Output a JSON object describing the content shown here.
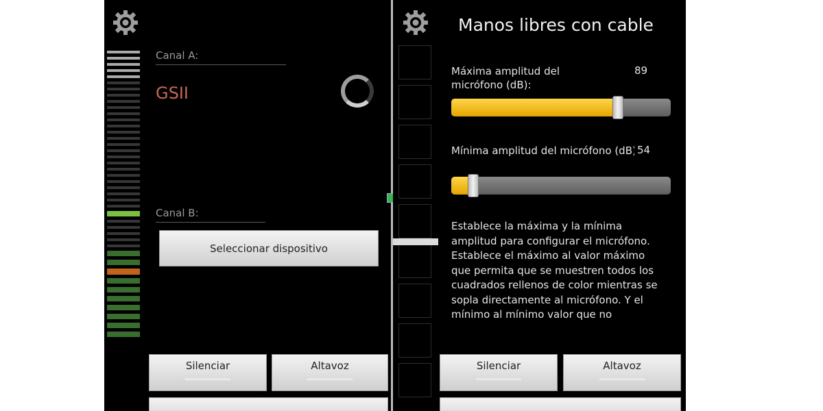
{
  "left_screen": {
    "channel_a_label": "Canal A:",
    "channel_a_device": "GSII",
    "channel_b_label": "Canal B:",
    "select_device_button": "Seleccionar dispositivo",
    "mute_button": "Silenciar",
    "speaker_button": "Altavoz"
  },
  "right_screen": {
    "title": "Manos libres con cable",
    "max_amplitude_label": "Máxima amplitud del micrófono (dB):",
    "max_amplitude_value": "89",
    "max_amplitude_fraction": 0.76,
    "min_amplitude_label": "Mínima amplitud del micrófono (dB):",
    "min_amplitude_value": "54",
    "min_amplitude_fraction": 0.1,
    "description": "Establece la máxima y la mínima amplitud para configurar el micrófono. Establece el máximo al valor máximo que permita que se muestren todos los cuadrados rellenos de color mientras se sopla directamente al micrófono. Y el mínimo al mínimo valor que no",
    "mute_button": "Silenciar",
    "speaker_button": "Altavoz"
  },
  "colors": {
    "accent_yellow": "#f0b400",
    "meter_green": "#8bd44a",
    "meter_orange": "#d7701e",
    "device_text": "#c56a52"
  },
  "icons": [
    "gear-icon",
    "spinner-icon"
  ]
}
